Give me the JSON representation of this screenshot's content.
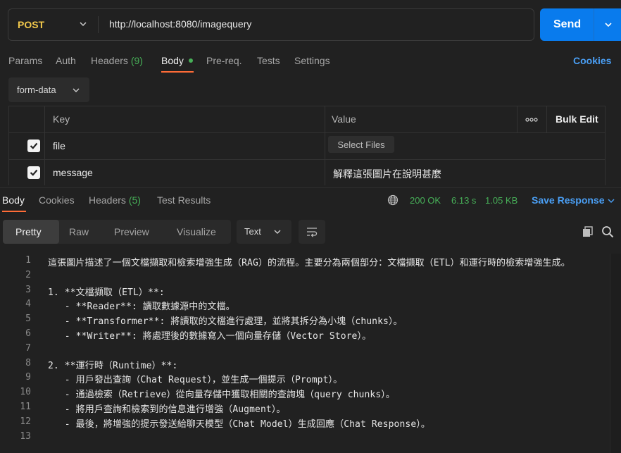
{
  "request": {
    "method": "POST",
    "url": "http://localhost:8080/imagequery",
    "send_label": "Send"
  },
  "request_tabs": {
    "params": "Params",
    "auth": "Auth",
    "headers": "Headers",
    "headers_count": "(9)",
    "body": "Body",
    "prereq": "Pre-req.",
    "tests": "Tests",
    "settings": "Settings",
    "cookies": "Cookies"
  },
  "body_type": "form-data",
  "params_table": {
    "headers": {
      "key": "Key",
      "value": "Value",
      "bulk_edit": "Bulk Edit"
    },
    "rows": [
      {
        "checked": true,
        "key": "file",
        "value_button": "Select Files"
      },
      {
        "checked": true,
        "key": "message",
        "value": "解釋這張圖片在說明甚麼"
      }
    ]
  },
  "response_tabs": {
    "body": "Body",
    "cookies": "Cookies",
    "headers": "Headers",
    "headers_count": "(5)",
    "test_results": "Test Results"
  },
  "response_status": {
    "status": "200 OK",
    "time": "6.13 s",
    "size": "1.05 KB",
    "save_response": "Save Response"
  },
  "view_tabs": {
    "pretty": "Pretty",
    "raw": "Raw",
    "preview": "Preview",
    "visualize": "Visualize",
    "format": "Text"
  },
  "response_body": [
    {
      "n": "1",
      "text": "這張圖片描述了一個文檔擷取和檢索增強生成（RAG）的流程。主要分為兩個部分：文檔擷取（ETL）和運行時的檢索增強生成。"
    },
    {
      "n": "2",
      "text": ""
    },
    {
      "n": "3",
      "text": "1. **文檔擷取（ETL）**:"
    },
    {
      "n": "4",
      "text": "   - **Reader**: 讀取數據源中的文檔。"
    },
    {
      "n": "5",
      "text": "   - **Transformer**: 將讀取的文檔進行處理，並將其拆分為小塊（chunks）。"
    },
    {
      "n": "6",
      "text": "   - **Writer**: 將處理後的數據寫入一個向量存儲（Vector Store）。"
    },
    {
      "n": "7",
      "text": ""
    },
    {
      "n": "8",
      "text": "2. **運行時（Runtime）**:"
    },
    {
      "n": "9",
      "text": "   - 用戶發出查詢（Chat Request），並生成一個提示（Prompt）。"
    },
    {
      "n": "10",
      "text": "   - 通過檢索（Retrieve）從向量存儲中獲取相關的查詢塊（query chunks）。"
    },
    {
      "n": "11",
      "text": "   - 將用戶查詢和檢索到的信息進行增強（Augment）。"
    },
    {
      "n": "12",
      "text": "   - 最後，將增強的提示發送給聊天模型（Chat Model）生成回應（Chat Response）。"
    },
    {
      "n": "13",
      "text": ""
    }
  ],
  "colors": {
    "background": "#212121",
    "accent_blue": "#097bed",
    "method_yellow": "#f2c94c",
    "status_green": "#47b058",
    "tab_underline": "#ff6c37"
  },
  "icons": {
    "method_dropdown": "chevron-down-icon",
    "send_dropdown": "chevron-down-icon",
    "more": "more-horizontal-icon",
    "globe": "globe-icon",
    "wrap": "wrap-lines-icon",
    "copy": "copy-icon",
    "search": "search-icon"
  }
}
